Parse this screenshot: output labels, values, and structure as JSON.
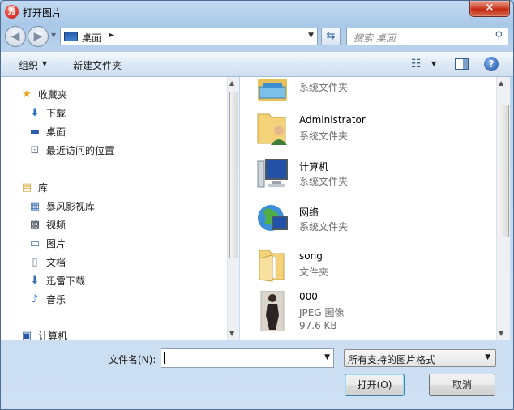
{
  "window": {
    "title": "打开图片",
    "close_glyph": "×"
  },
  "nav": {
    "back_glyph": "◀",
    "forward_glyph": "▶",
    "address": {
      "location": "桌面",
      "separator": "▸"
    },
    "search_placeholder": "搜索 桌面"
  },
  "toolbar": {
    "organize": "组织",
    "new_folder": "新建文件夹"
  },
  "navpane": {
    "items": [
      {
        "label": "收藏夹",
        "icon": "star-icon",
        "glyph": "★",
        "color": "#e8a824"
      },
      {
        "label": "下载",
        "icon": "download-folder-icon",
        "glyph": "⬇",
        "color": "#2f6fbf"
      },
      {
        "label": "桌面",
        "icon": "desktop-icon",
        "glyph": "▬",
        "color": "#2a5ba8"
      },
      {
        "label": "最近访问的位置",
        "icon": "recent-places-icon",
        "glyph": "⊡",
        "color": "#6c7d90"
      },
      {
        "label": "库",
        "icon": "library-icon",
        "glyph": "▤",
        "color": "#d9a531"
      },
      {
        "label": "暴风影视库",
        "icon": "video-library-icon",
        "glyph": "▦",
        "color": "#3a6fb0"
      },
      {
        "label": "视频",
        "icon": "video-icon",
        "glyph": "▩",
        "color": "#404a56"
      },
      {
        "label": "图片",
        "icon": "pictures-icon",
        "glyph": "▭",
        "color": "#3d7ab8"
      },
      {
        "label": "文档",
        "icon": "documents-icon",
        "glyph": "▯",
        "color": "#6d7c8c"
      },
      {
        "label": "迅雷下载",
        "icon": "thunder-download-icon",
        "glyph": "⬇",
        "color": "#3a6fb0"
      },
      {
        "label": "音乐",
        "icon": "music-icon",
        "glyph": "♪",
        "color": "#2d7bd1"
      },
      {
        "label": "计算机",
        "icon": "computer-icon",
        "glyph": "▣",
        "color": "#2a5ba8"
      }
    ]
  },
  "files": [
    {
      "name": "",
      "type": "系统文件夹",
      "icon": "libraries-folder-icon"
    },
    {
      "name": "Administrator",
      "type": "系统文件夹",
      "icon": "user-folder-icon"
    },
    {
      "name": "计算机",
      "type": "系统文件夹",
      "icon": "computer-icon"
    },
    {
      "name": "网络",
      "type": "系统文件夹",
      "icon": "network-icon"
    },
    {
      "name": "song",
      "type": "文件夹",
      "icon": "folder-icon"
    },
    {
      "name": "000",
      "type": "JPEG 图像",
      "size": "97.6 KB",
      "icon": "photo-thumbnail-icon"
    }
  ],
  "bottom": {
    "filename_label": "文件名(N):",
    "filename_value": "",
    "filter": "所有支持的图片格式",
    "open": "打开(O)",
    "cancel": "取消"
  },
  "colors": {
    "accent": "#3c7fb1",
    "titlebar": "#a9c8e8",
    "close": "#c12b12"
  }
}
